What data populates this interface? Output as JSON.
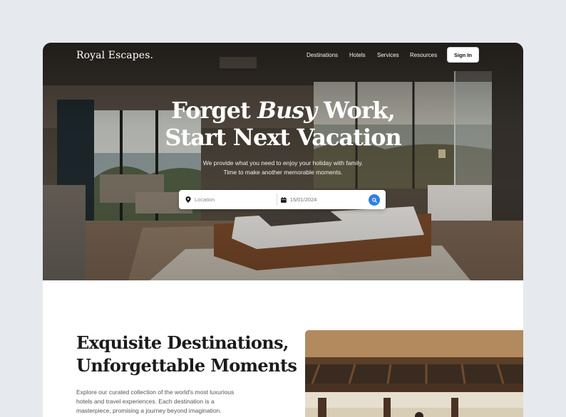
{
  "brand": {
    "name": "Royal Escapes."
  },
  "nav": {
    "links": [
      "Destinations",
      "Hotels",
      "Services",
      "Resources"
    ],
    "signin_label": "Sign In"
  },
  "hero": {
    "title_line1_prefix": "Forget ",
    "title_line1_emphasis": "Busy",
    "title_line1_suffix": " Work,",
    "title_line2": "Start Next Vacation",
    "subtitle_line1": "We provide what you need to enjoy your  holiday with family.",
    "subtitle_line2": "Time to make another memorable moments."
  },
  "search": {
    "location_placeholder": "Location",
    "date_value": "15/01/2024",
    "icons": {
      "location": "map-pin-icon",
      "date": "calendar-icon",
      "submit": "search-icon"
    },
    "accent_color": "#2f7fe4"
  },
  "destinations": {
    "title_line1": "Exquisite Destinations,",
    "title_line2": "Unforgettable Moments",
    "body_line1": "Explore our curated collection of the world's most luxurious",
    "body_line2": "hotels and travel experiences. Each destination is a",
    "body_line3": "masterpiece, promising a journey beyond imagination."
  }
}
